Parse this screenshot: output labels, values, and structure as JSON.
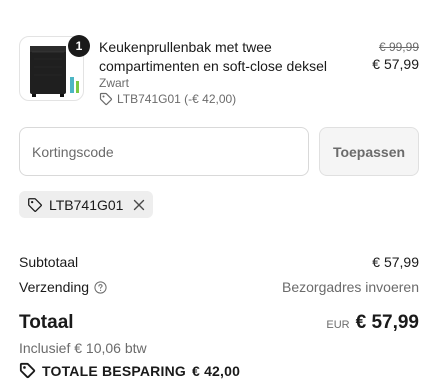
{
  "line_item": {
    "quantity": "1",
    "title": "Keukenprullenbak met twee compartimenten en soft-close deksel",
    "variant": "Zwart",
    "discount_text": "LTB741G01 (-€ 42,00)",
    "original_price": "€ 99,99",
    "final_price": "€ 57,99",
    "image_icon": "kitchen-bin-image"
  },
  "discount": {
    "placeholder": "Kortingscode",
    "value": "",
    "apply_label": "Toepassen",
    "applied_code": "LTB741G01"
  },
  "summary": {
    "subtotal_label": "Subtotaal",
    "subtotal_value": "€ 57,99",
    "shipping_label": "Verzending",
    "shipping_value": "Bezorgadres invoeren",
    "total_label": "Totaal",
    "currency_code": "EUR",
    "total_value": "€ 57,99",
    "tax_text": "Inclusief € 10,06 btw",
    "savings_label": "TOTALE BESPARING",
    "savings_value": "€ 42,00"
  },
  "colors": {
    "text": "#1a1a1a",
    "muted": "#6b6b6b",
    "border": "#d9d9d9",
    "chip_bg": "#eeeeee"
  }
}
